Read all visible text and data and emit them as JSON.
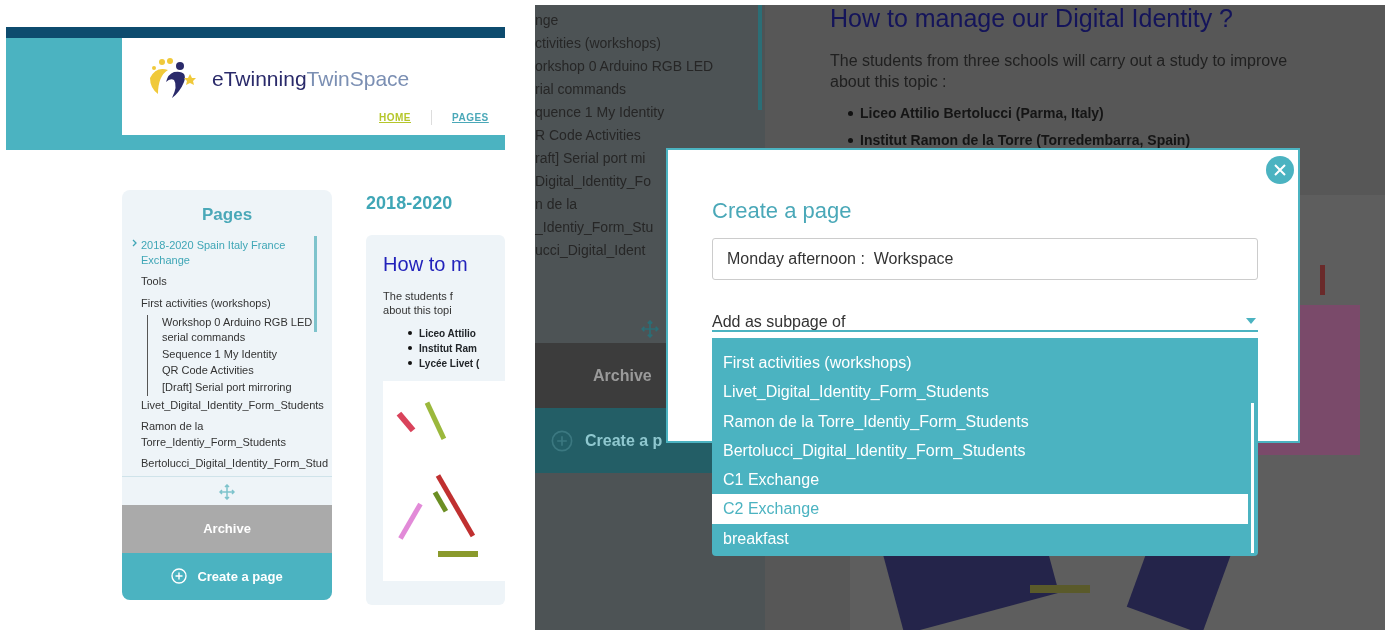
{
  "left_screen": {
    "logo": {
      "brand": "eTwinning",
      "product": "TwinSpace"
    },
    "nav": [
      {
        "label": "HOME",
        "selected": true
      },
      {
        "label": "PAGES",
        "selected": false
      }
    ],
    "sidebar": {
      "title": "Pages",
      "items": [
        {
          "label": "2018-2020 Spain Italy France Exchange",
          "selected": true
        },
        {
          "label": "Tools",
          "selected": false
        },
        {
          "label": "First activities (workshops)",
          "selected": false,
          "children": [
            {
              "label": "Workshop 0 Arduino RGB LED serial commands",
              "selected": false
            },
            {
              "label": "Sequence 1 My Identity",
              "selected": false
            },
            {
              "label": "QR Code Activities",
              "selected": false
            },
            {
              "label": "[Draft] Serial port mirroring",
              "selected": false
            }
          ]
        },
        {
          "label": "Livet_Digital_Identity_Form_Students",
          "selected": false
        },
        {
          "label": "Ramon de la Torre_Identiy_Form_Students",
          "selected": false
        },
        {
          "label": "Bertolucci_Digital_Identity_Form_Stud",
          "selected": false
        }
      ],
      "archive_button": "Archive",
      "create_button": "Create a page"
    },
    "content": {
      "heading": "2018-2020",
      "article_title": "How to m",
      "intro": [
        "The students f",
        "about this topi"
      ],
      "schools": [
        "Liceo Attilio",
        "Institut Ram",
        "Lycée Livet ("
      ]
    }
  },
  "right_screen": {
    "sidebar": {
      "lines": [
        "nge",
        "ctivities (workshops)",
        "orkshop 0 Arduino RGB LED",
        "rial commands",
        "quence 1 My Identity",
        "R Code Activities",
        "raft] Serial port mi",
        "Digital_Identity_Fo",
        "n de la",
        "_Identiy_Form_Stu",
        "ucci_Digital_Ident"
      ],
      "archive_button": "Archive",
      "create_button": "Create a p"
    },
    "content": {
      "article_title": "How to manage our Digital Identity ?",
      "intro": [
        "The students from three schools will carry out a study to improve",
        "about this topic :"
      ],
      "schools": [
        "Liceo Attilio Bertolucci (Parma, Italy)",
        "Institut Ramon de la Torre (Torredembarra, Spain)"
      ]
    },
    "dialog": {
      "title": "Create a page",
      "page_name": "Monday afternoon :  Workspace",
      "parent_label": "Add as subpage of",
      "options": [
        {
          "label": "First activities (workshops)",
          "selected": false
        },
        {
          "label": "Livet_Digital_Identity_Form_Students",
          "selected": false
        },
        {
          "label": "Ramon de la Torre_Identiy_Form_Students",
          "selected": false
        },
        {
          "label": "Bertolucci_Digital_Identity_Form_Students",
          "selected": false
        },
        {
          "label": "C1 Exchange",
          "selected": false
        },
        {
          "label": "C2 Exchange",
          "selected": true
        },
        {
          "label": "breakfast",
          "selected": false
        }
      ]
    }
  }
}
